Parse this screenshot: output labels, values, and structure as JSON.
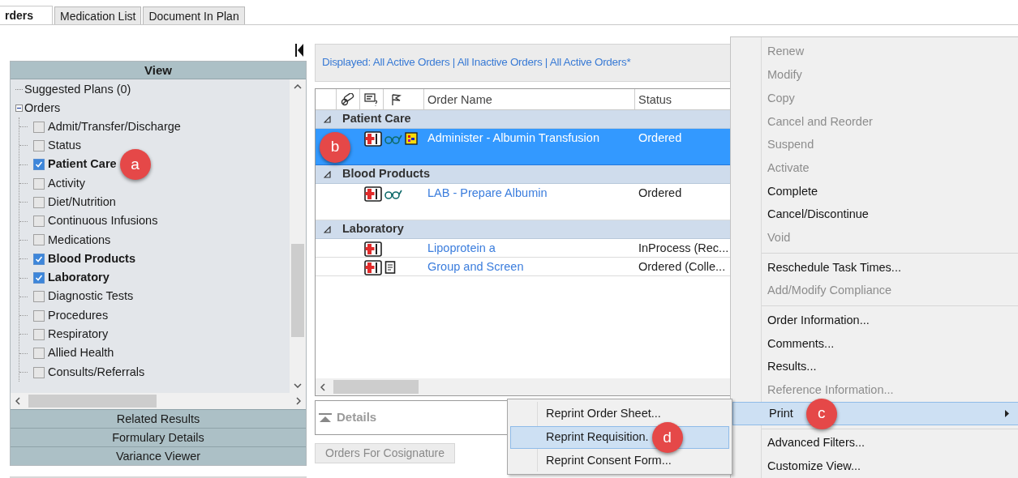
{
  "tabs": [
    {
      "label": "rders",
      "selected": true
    },
    {
      "label": "Medication List",
      "selected": false
    },
    {
      "label": "Document In Plan",
      "selected": false
    }
  ],
  "view_panel": {
    "title": "View",
    "tree": [
      {
        "label": "Suggested Plans (0)"
      },
      {
        "label": "Orders",
        "expanded": true,
        "children": [
          {
            "label": "Admit/Transfer/Discharge",
            "checked": false
          },
          {
            "label": "Status",
            "checked": false
          },
          {
            "label": "Patient Care",
            "checked": true,
            "marker": "a"
          },
          {
            "label": "Activity",
            "checked": false
          },
          {
            "label": "Diet/Nutrition",
            "checked": false
          },
          {
            "label": "Continuous Infusions",
            "checked": false
          },
          {
            "label": "Medications",
            "checked": false
          },
          {
            "label": "Blood Products",
            "checked": true
          },
          {
            "label": "Laboratory",
            "checked": true
          },
          {
            "label": "Diagnostic Tests",
            "checked": false
          },
          {
            "label": "Procedures",
            "checked": false
          },
          {
            "label": "Respiratory",
            "checked": false
          },
          {
            "label": "Allied Health",
            "checked": false
          },
          {
            "label": "Consults/Referrals",
            "checked": false
          }
        ]
      }
    ],
    "sections": [
      "Related Results",
      "Formulary Details",
      "Variance Viewer"
    ]
  },
  "displayed": "Displayed: All Active Orders | All Inactive Orders | All Active Orders*",
  "table": {
    "columns": [
      "Order Name",
      "Status"
    ],
    "groups": [
      {
        "name": "Patient Care",
        "expanded": true,
        "orders": [
          {
            "name": "Administer - Albumin Transfusion",
            "status": "Ordered",
            "icons": [
              {
                "kind": "hospital"
              },
              {
                "kind": "glasses"
              },
              {
                "kind": "chart"
              }
            ],
            "selected": true,
            "marker": "b"
          }
        ]
      },
      {
        "name": "Blood Products",
        "expanded": true,
        "orders": [
          {
            "name": "LAB - Prepare Albumin",
            "status": "Ordered",
            "icons": [
              {
                "kind": "hospital"
              },
              {
                "kind": "glasses"
              }
            ],
            "selected": false
          }
        ]
      },
      {
        "name": "Laboratory",
        "expanded": true,
        "orders": [
          {
            "name": "Lipoprotein a",
            "status": "InProcess (Rec...",
            "icons": [
              {
                "kind": "hospital"
              }
            ],
            "selected": false
          },
          {
            "name": "Group and Screen",
            "status": "Ordered (Colle...",
            "icons": [
              {
                "kind": "hospital"
              },
              {
                "kind": "document"
              }
            ],
            "selected": false
          }
        ]
      }
    ]
  },
  "details": {
    "label": "Details"
  },
  "cosign_button": "Orders For Cosignature",
  "context_menu": [
    {
      "kind": "item",
      "label": "Renew",
      "disabled": true,
      "selected": false
    },
    {
      "kind": "item",
      "label": "Modify",
      "disabled": true,
      "selected": false
    },
    {
      "kind": "item",
      "label": "Copy",
      "disabled": true,
      "selected": false
    },
    {
      "kind": "item",
      "label": "Cancel and Reorder",
      "disabled": true,
      "selected": false
    },
    {
      "kind": "item",
      "label": "Suspend",
      "disabled": true,
      "selected": false
    },
    {
      "kind": "item",
      "label": "Activate",
      "disabled": true,
      "selected": false
    },
    {
      "kind": "item",
      "label": "Complete",
      "disabled": false,
      "selected": false
    },
    {
      "kind": "item",
      "label": "Cancel/Discontinue",
      "disabled": false,
      "selected": false
    },
    {
      "kind": "item",
      "label": "Void",
      "disabled": true,
      "selected": false
    },
    {
      "kind": "separator"
    },
    {
      "kind": "item",
      "label": "Reschedule Task Times...",
      "disabled": false,
      "selected": false
    },
    {
      "kind": "item",
      "label": "Add/Modify Compliance",
      "disabled": true,
      "selected": false
    },
    {
      "kind": "separator"
    },
    {
      "kind": "item",
      "label": "Order Information...",
      "disabled": false,
      "selected": false
    },
    {
      "kind": "item",
      "label": "Comments...",
      "disabled": false,
      "selected": false
    },
    {
      "kind": "item",
      "label": "Results...",
      "disabled": false,
      "selected": false
    },
    {
      "kind": "item",
      "label": "Reference Information...",
      "disabled": true,
      "selected": false
    },
    {
      "kind": "item",
      "label": "Print",
      "disabled": false,
      "selected": true,
      "submenu": true,
      "marker": "c"
    },
    {
      "kind": "separator"
    },
    {
      "kind": "item",
      "label": "Advanced Filters...",
      "disabled": false,
      "selected": false
    },
    {
      "kind": "item",
      "label": "Customize View...",
      "disabled": false,
      "selected": false
    }
  ],
  "print_submenu": [
    {
      "label": "Reprint Order Sheet...",
      "selected": false
    },
    {
      "label": "Reprint Requisition.",
      "selected": true,
      "marker": "d"
    },
    {
      "label": "Reprint Consent Form...",
      "selected": false
    }
  ]
}
